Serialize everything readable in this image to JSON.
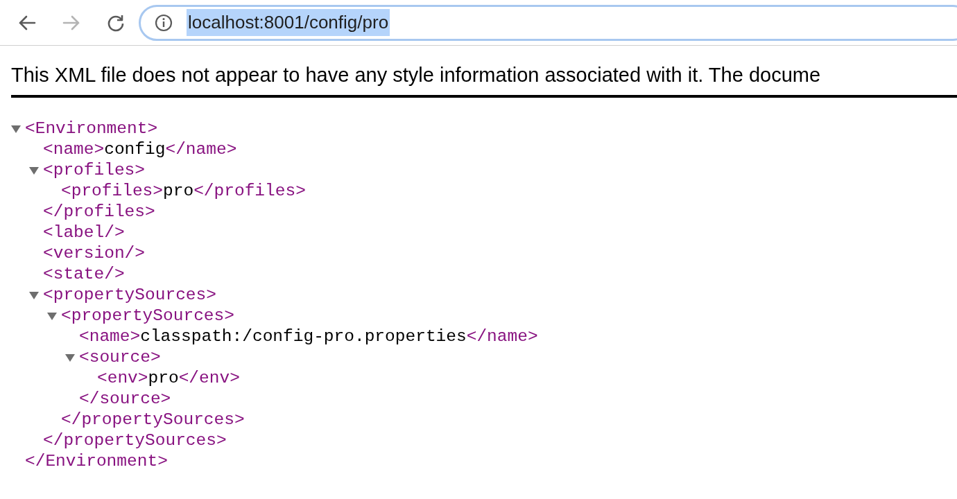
{
  "toolbar": {
    "back": {
      "disabled": false
    },
    "forward": {
      "disabled": true
    },
    "url": "localhost:8001/config/pro",
    "url_selected": true
  },
  "notice": "This XML file does not appear to have any style information associated with it. The docume",
  "tree": {
    "kind": "node",
    "open": "<Environment>",
    "close": "</Environment>",
    "expanded": true,
    "children": [
      {
        "kind": "leaf",
        "open": "<name>",
        "value": "config",
        "close": "</name>"
      },
      {
        "kind": "node",
        "open": "<profiles>",
        "close": "</profiles>",
        "expanded": true,
        "children": [
          {
            "kind": "leaf",
            "open": "<profiles>",
            "value": "pro",
            "close": "</profiles>"
          }
        ]
      },
      {
        "kind": "empty",
        "tag": "<label/>"
      },
      {
        "kind": "empty",
        "tag": "<version/>"
      },
      {
        "kind": "empty",
        "tag": "<state/>"
      },
      {
        "kind": "node",
        "open": "<propertySources>",
        "close": "</propertySources>",
        "expanded": true,
        "children": [
          {
            "kind": "node",
            "open": "<propertySources>",
            "close": "</propertySources>",
            "expanded": true,
            "children": [
              {
                "kind": "leaf",
                "open": "<name>",
                "value": "classpath:/config-pro.properties",
                "close": "</name>"
              },
              {
                "kind": "node",
                "open": "<source>",
                "close": "</source>",
                "expanded": true,
                "children": [
                  {
                    "kind": "leaf",
                    "open": "<env>",
                    "value": "pro",
                    "close": "</env>"
                  }
                ]
              }
            ]
          }
        ]
      }
    ]
  }
}
